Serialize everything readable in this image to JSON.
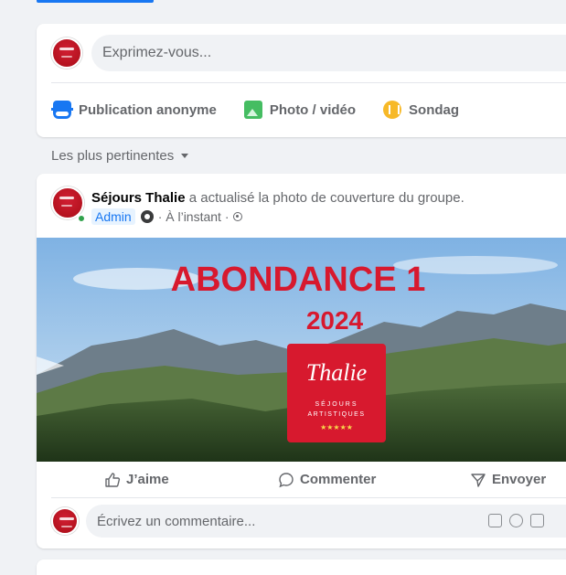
{
  "composer": {
    "placeholder": "Exprimez-vous...",
    "actions": [
      {
        "label": "Publication anonyme",
        "icon": "anonymous-icon"
      },
      {
        "label": "Photo / vidéo",
        "icon": "photo-icon"
      },
      {
        "label": "Sondag",
        "icon": "poll-icon"
      }
    ]
  },
  "feed": {
    "sort_label": "Les plus pertinentes"
  },
  "post": {
    "author": "Séjours Thalie",
    "action_text": " a actualisé la photo de couverture du groupe.",
    "role": "Admin",
    "time": "À l’instant",
    "cover": {
      "headline": "ABONDANCE 1",
      "year": "2024",
      "logo_name": "Thalie",
      "logo_line1": "SÉJOURS",
      "logo_line2": "ARTISTIQUES",
      "logo_stars": "★★★★★"
    },
    "buttons": {
      "like": "J’aime",
      "comment": "Commenter",
      "send": "Envoyer"
    },
    "comment_placeholder": "Écrivez un commentaire..."
  },
  "colors": {
    "accent": "#1877f2",
    "brand_red": "#d7192e",
    "online": "#31a24c"
  }
}
